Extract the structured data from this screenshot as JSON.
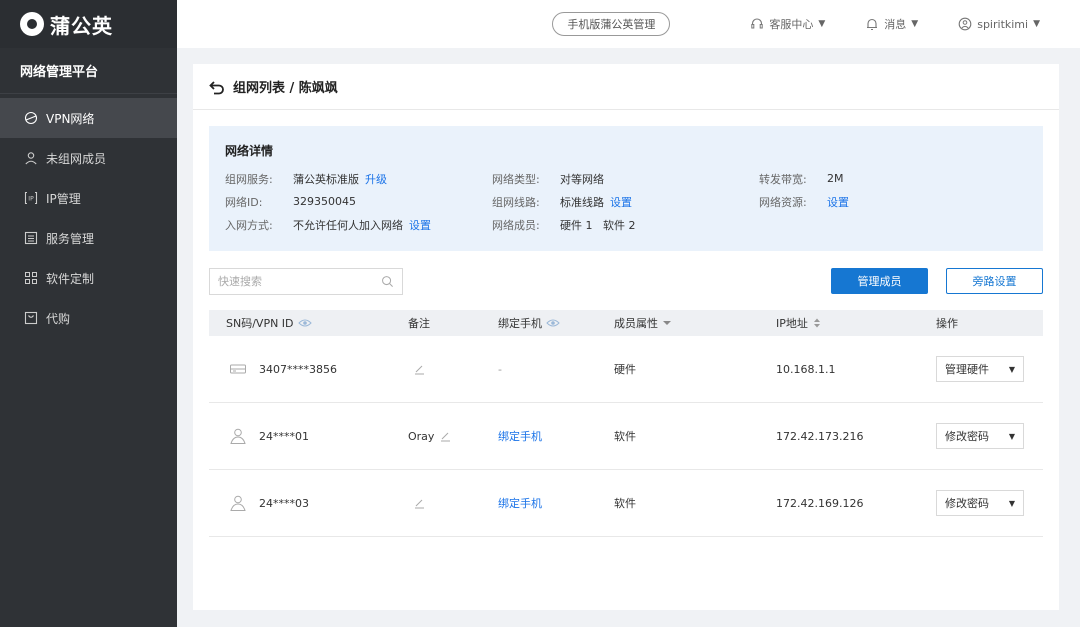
{
  "brand": {
    "name": "蒲公英"
  },
  "sidebar": {
    "platform": "网络管理平台",
    "items": [
      {
        "label": "VPN网络",
        "icon": "network-icon",
        "active": true
      },
      {
        "label": "未组网成员",
        "icon": "user-icon",
        "active": false
      },
      {
        "label": "IP管理",
        "icon": "ip-icon",
        "active": false
      },
      {
        "label": "服务管理",
        "icon": "service-icon",
        "active": false
      },
      {
        "label": "软件定制",
        "icon": "grid-icon",
        "active": false
      },
      {
        "label": "代购",
        "icon": "bag-icon",
        "active": false
      }
    ]
  },
  "topbar": {
    "mobile_label": "手机版蒲公英管理",
    "support_label": "客服中心",
    "messages_label": "消息",
    "username": "spiritkimi"
  },
  "page": {
    "breadcrumb": "组网列表 / 陈飒飒"
  },
  "details": {
    "title": "网络详情",
    "service_label": "组网服务:",
    "service_value": "蒲公英标准版",
    "service_link": "升级",
    "type_label": "网络类型:",
    "type_value": "对等网络",
    "bandwidth_label": "转发带宽:",
    "bandwidth_value": "2M",
    "id_label": "网络ID:",
    "id_value": "329350045",
    "line_label": "组网线路:",
    "line_value": "标准线路",
    "line_link": "设置",
    "resource_label": "网络资源:",
    "resource_link": "设置",
    "join_label": "入网方式:",
    "join_value": "不允许任何人加入网络",
    "join_link": "设置",
    "members_label": "网络成员:",
    "members_value": "硬件 1   软件 2"
  },
  "search": {
    "placeholder": "快速搜索"
  },
  "buttons": {
    "manage_members": "管理成员",
    "bypass_settings": "旁路设置"
  },
  "table": {
    "headers": [
      "SN码/VPN ID",
      "备注",
      "绑定手机",
      "成员属性",
      "IP地址",
      "操作"
    ],
    "rows": [
      {
        "id": "3407****3856",
        "note": "",
        "phone": "-",
        "type": "硬件",
        "ip": "10.168.1.1",
        "action": "管理硬件",
        "kind": "hardware"
      },
      {
        "id": "24****01",
        "note": "Oray",
        "phone": "绑定手机",
        "type": "软件",
        "ip": "172.42.173.216",
        "action": "修改密码",
        "kind": "software"
      },
      {
        "id": "24****03",
        "note": "",
        "phone": "绑定手机",
        "type": "软件",
        "ip": "172.42.169.126",
        "action": "修改密码",
        "kind": "software"
      }
    ]
  },
  "colors": {
    "primary": "#1677d2",
    "sidebar": "#2f3236",
    "detail_bg": "#eaf2fb"
  }
}
